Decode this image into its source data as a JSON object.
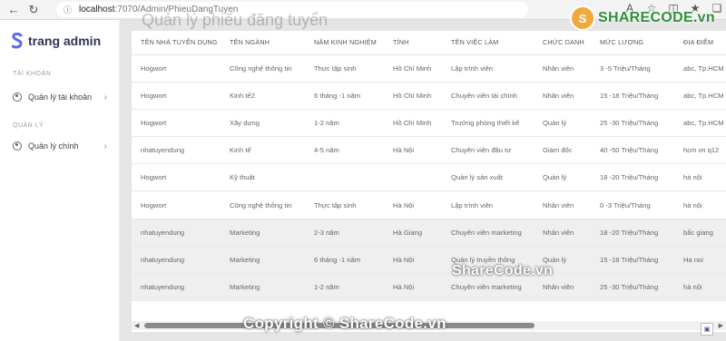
{
  "browser": {
    "url_host": "localhost",
    "url_rest": ":7070/Admin/PhieuDangTuyen"
  },
  "sidebar": {
    "brand": "trang admin",
    "sections": [
      {
        "title": "TÀI KHOẢN",
        "item": "Quản lý tài khoản"
      },
      {
        "title": "QUẢN LÝ",
        "item": "Quản lý chính"
      }
    ]
  },
  "main": {
    "page_title": "Quản lý phiếu đăng tuyển"
  },
  "table": {
    "headers": [
      "TÊN NHÀ TUYỂN DỤNG",
      "TÊN NGÀNH",
      "NĂM KINH NGHIỆM",
      "TỈNH",
      "TÊN VIỆC LÀM",
      "CHỨC DANH",
      "MỨC LƯƠNG",
      "ĐỊA ĐIỂM"
    ],
    "rows": [
      [
        "Hogwort",
        "Công nghệ thông tin",
        "Thực tập sinh",
        "Hồ Chí Minh",
        "Lập trình viên",
        "Nhân viên",
        "3 -5 Triệu/Tháng",
        "abc, Tp.HCM"
      ],
      [
        "Hogwort",
        "Kinh tế2",
        "6 tháng -1 năm",
        "Hồ Chí Minh",
        "Chuyên viên tài chính",
        "Nhân viên",
        "15 -18 Triệu/Tháng",
        "abc, Tp.HCM"
      ],
      [
        "Hogwort",
        "Xây dựng",
        "1-2 năm",
        "Hồ Chí Minh",
        "Trưởng phòng thiết kế",
        "Quản lý",
        "25 -30 Triệu/Tháng",
        "abc, Tp.HCM"
      ],
      [
        "nhatuyendung",
        "Kinh tế",
        "4-5 năm",
        "Hà Nội",
        "Chuyên viên đầu tư",
        "Giám đốc",
        "40 -50 Triệu/Tháng",
        "hcm vn q12"
      ],
      [
        "Hogwort",
        "Kỹ thuật",
        "",
        "",
        "Quản lý sản xuất",
        "Quản lý",
        "18 -20 Triệu/Tháng",
        "hà nội"
      ],
      [
        "Hogwort",
        "Công nghệ thông tin",
        "Thực tập sinh",
        "Hà Nội",
        "Lập trình viên",
        "Nhân viên",
        "0 -3 Triệu/Tháng",
        "hà nội"
      ],
      [
        "nhatuyendung",
        "Marketing",
        "2-3 năm",
        "Hà Giang",
        "Chuyên viên marketing",
        "Nhân viên",
        "18 -20 Triệu/Tháng",
        "bắc giang"
      ],
      [
        "nhatuyendung",
        "Marketing",
        "6 tháng -1 năm",
        "Hà Nội",
        "Quản lý truyền thông",
        "Quản lý",
        "15 -18 Triệu/Tháng",
        "Ha noi"
      ],
      [
        "nhatuyendung",
        "Marketing",
        "1-2 năm",
        "Hà Nội",
        "Chuyên viên marketing",
        "Nhân viên",
        "25 -30 Triệu/Tháng",
        "hà nội"
      ]
    ]
  },
  "watermarks": {
    "logo_text": "SHARECODE.vn",
    "logo_letter": "S",
    "center": "ShareCode.vn",
    "bottom": "Copyright © ShareCode.vn"
  },
  "icons": {
    "back": "back-arrow-icon",
    "forward": "forward-arrow-icon",
    "refresh": "refresh-icon",
    "lock": "lock-icon"
  }
}
